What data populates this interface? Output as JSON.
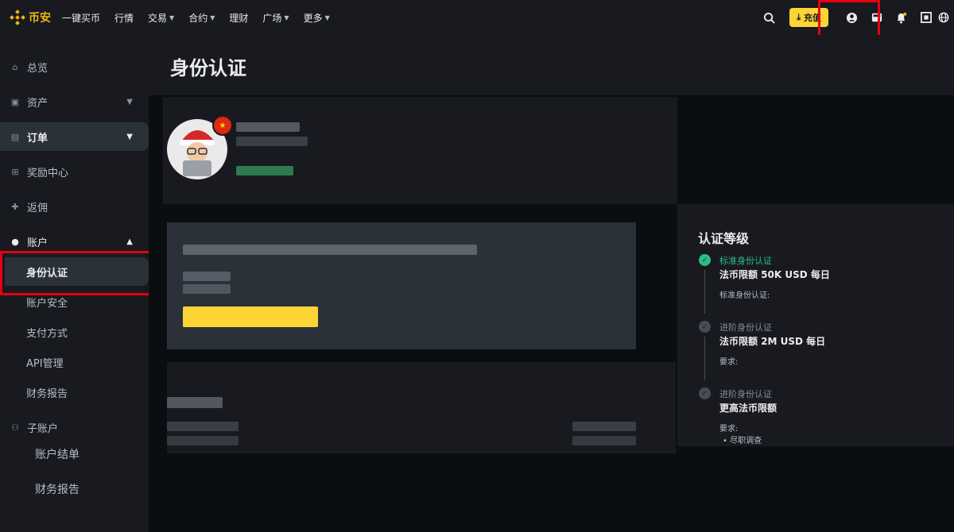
{
  "brand": {
    "name": "币安"
  },
  "nav": [
    {
      "label": "一键买币",
      "dropdown": false
    },
    {
      "label": "行情",
      "dropdown": false
    },
    {
      "label": "交易",
      "dropdown": true
    },
    {
      "label": "合约",
      "dropdown": true
    },
    {
      "label": "理财",
      "dropdown": false
    },
    {
      "label": "广场",
      "dropdown": true
    },
    {
      "label": "更多",
      "dropdown": true
    }
  ],
  "header_actions": {
    "deposit_label": "充值"
  },
  "sidebar": {
    "overview": "总览",
    "assets": "资产",
    "orders": "订单",
    "rewards": "奖励中心",
    "referral": "返佣",
    "account": "账户",
    "account_items": [
      "身份认证",
      "账户安全",
      "支付方式",
      "API管理",
      "财务报告"
    ],
    "subaccount": "子账户",
    "subaccount_items": [
      "账户结单",
      "财务报告"
    ]
  },
  "page": {
    "title": "身份认证"
  },
  "verification": {
    "heading": "认证等级",
    "levels": [
      {
        "name": "标准身份认证",
        "limit": "法币限额 50K USD 每日",
        "note": "标准身份认证:",
        "done": true
      },
      {
        "name": "进阶身份认证",
        "limit": "法币限额 2M USD 每日",
        "note": "要求:",
        "done": false
      },
      {
        "name": "进阶身份认证",
        "limit": "更高法币限额",
        "note": "要求:",
        "bullet": "尽职调查",
        "done": false
      }
    ]
  },
  "colors": {
    "accent": "#fcd535",
    "brand": "#f0b90b",
    "success": "#2ebd85",
    "highlight": "#e60012"
  }
}
